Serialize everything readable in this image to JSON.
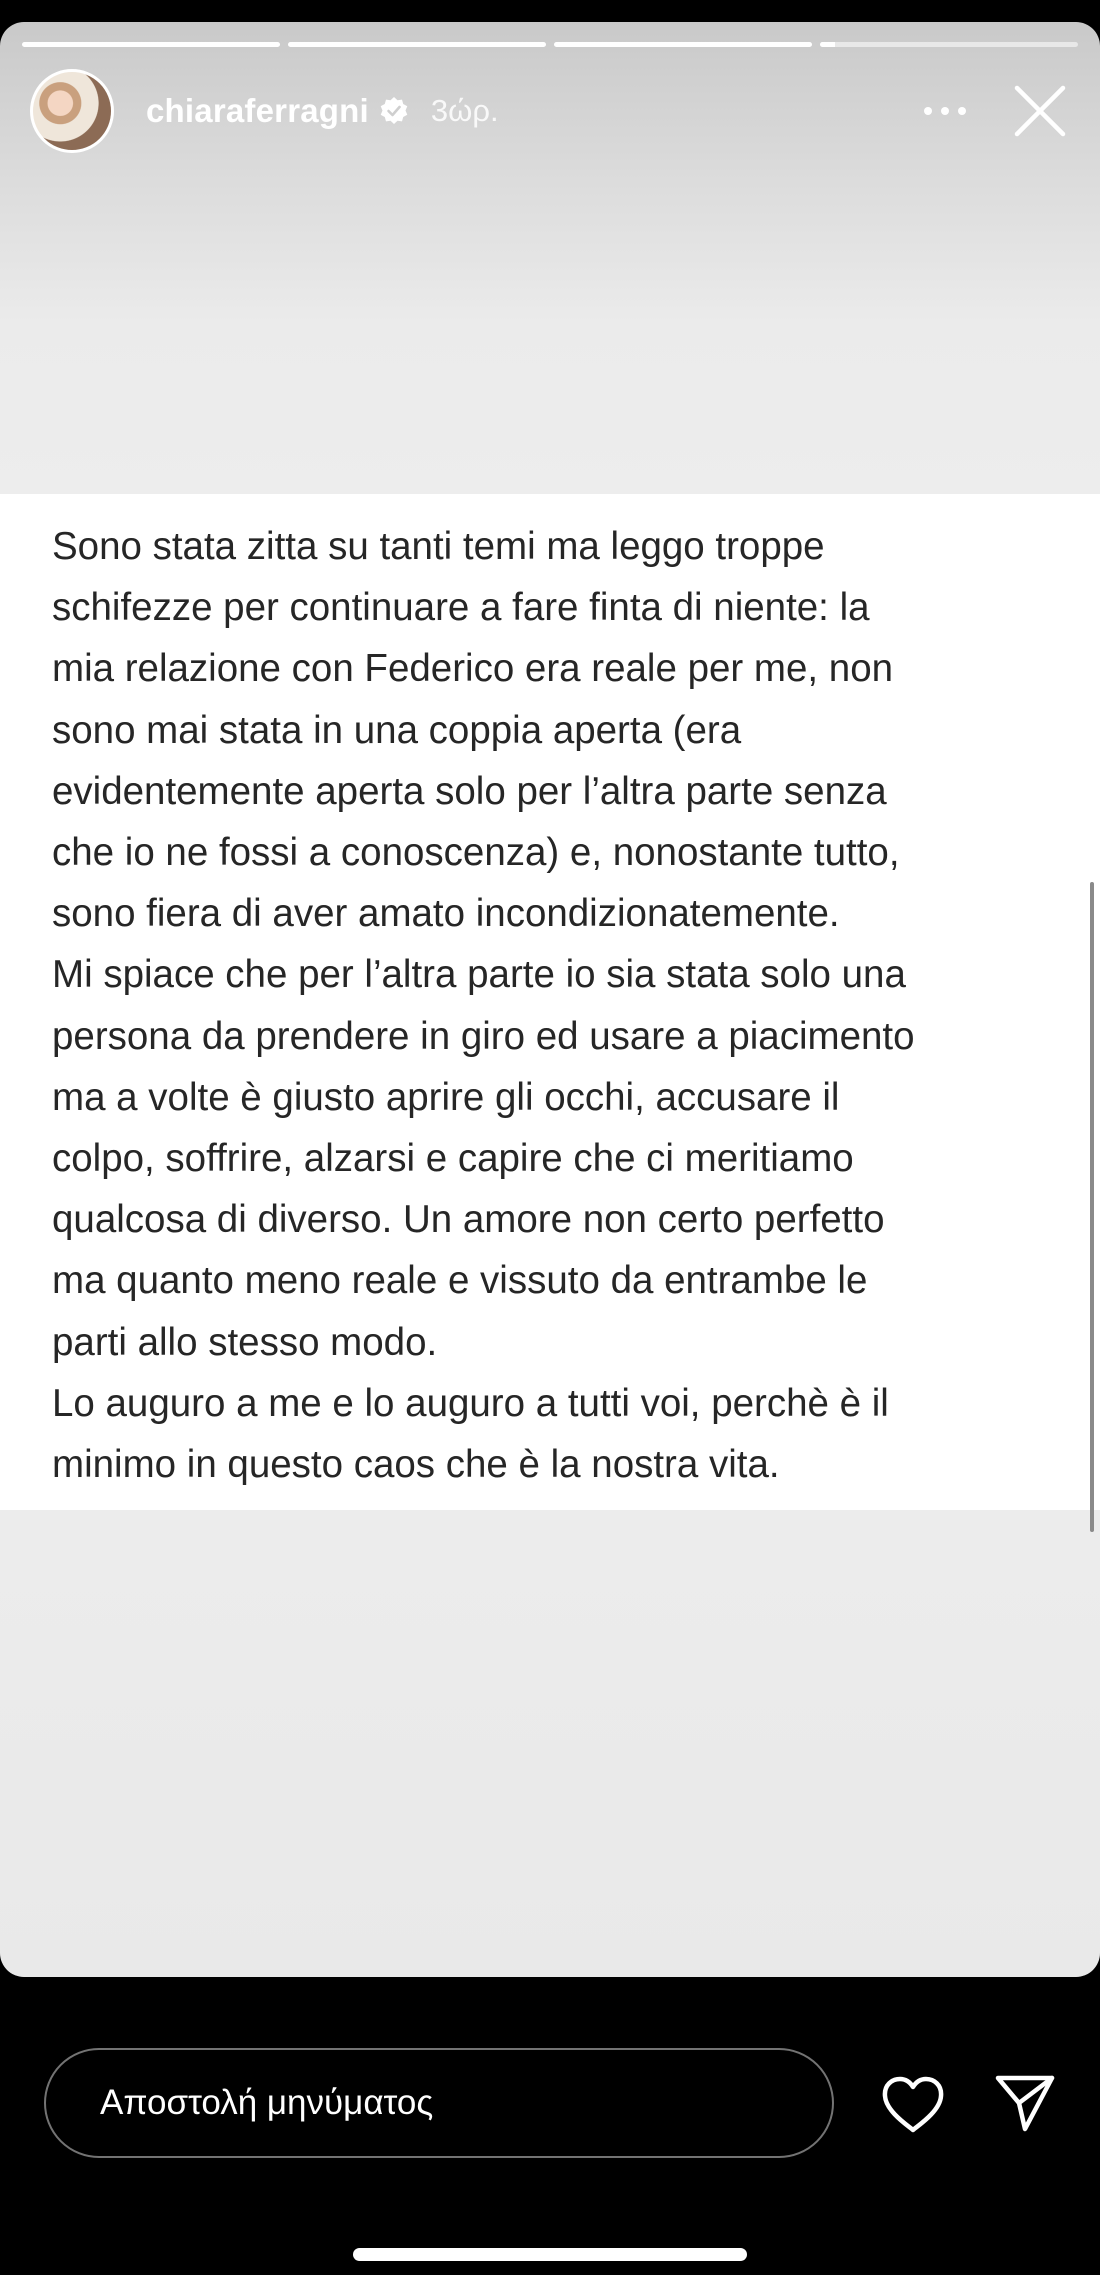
{
  "story": {
    "progress": [
      1,
      1,
      1,
      0.06
    ],
    "header": {
      "username": "chiaraferragni",
      "timestamp": "3ώρ.",
      "avatar_icon": "profile-photo",
      "verified_icon": "verified-badge-icon",
      "more_icon": "more-horizontal-icon",
      "close_icon": "close-icon"
    },
    "text_lines": [
      "Sono stata zitta su tanti temi ma leggo troppe",
      "schifezze per continuare a fare finta di niente: la",
      "mia relazione con Federico era reale per me, non",
      "sono mai stata in una coppia aperta (era",
      "evidentemente aperta solo per l’altra parte senza",
      "che io ne fossi a conoscenza) e, nonostante tutto,",
      "sono fiera di aver amato incondizionatemente.",
      "Mi spiace che per l’altra parte io sia stata solo una",
      "persona da prendere in giro ed usare a piacimento",
      "ma a volte è giusto aprire gli occhi, accusare il",
      "colpo, soffrire, alzarsi e capire che ci meritiamo",
      "qualcosa di diverso. Un amore non certo perfetto",
      "ma quanto meno reale e vissuto da entrambe le",
      "parti allo stesso modo.",
      "Lo auguro a me e lo auguro a tutti voi, perchè è il",
      "minimo in questo caos che è la nostra vita."
    ]
  },
  "footer": {
    "reply_placeholder": "Αποστολή μηνύματος",
    "like_icon": "heart-icon",
    "share_icon": "send-icon"
  },
  "colors": {
    "background": "#000000",
    "text": "#262626",
    "panel": "#ffffff",
    "story_bg": "#ececec"
  }
}
